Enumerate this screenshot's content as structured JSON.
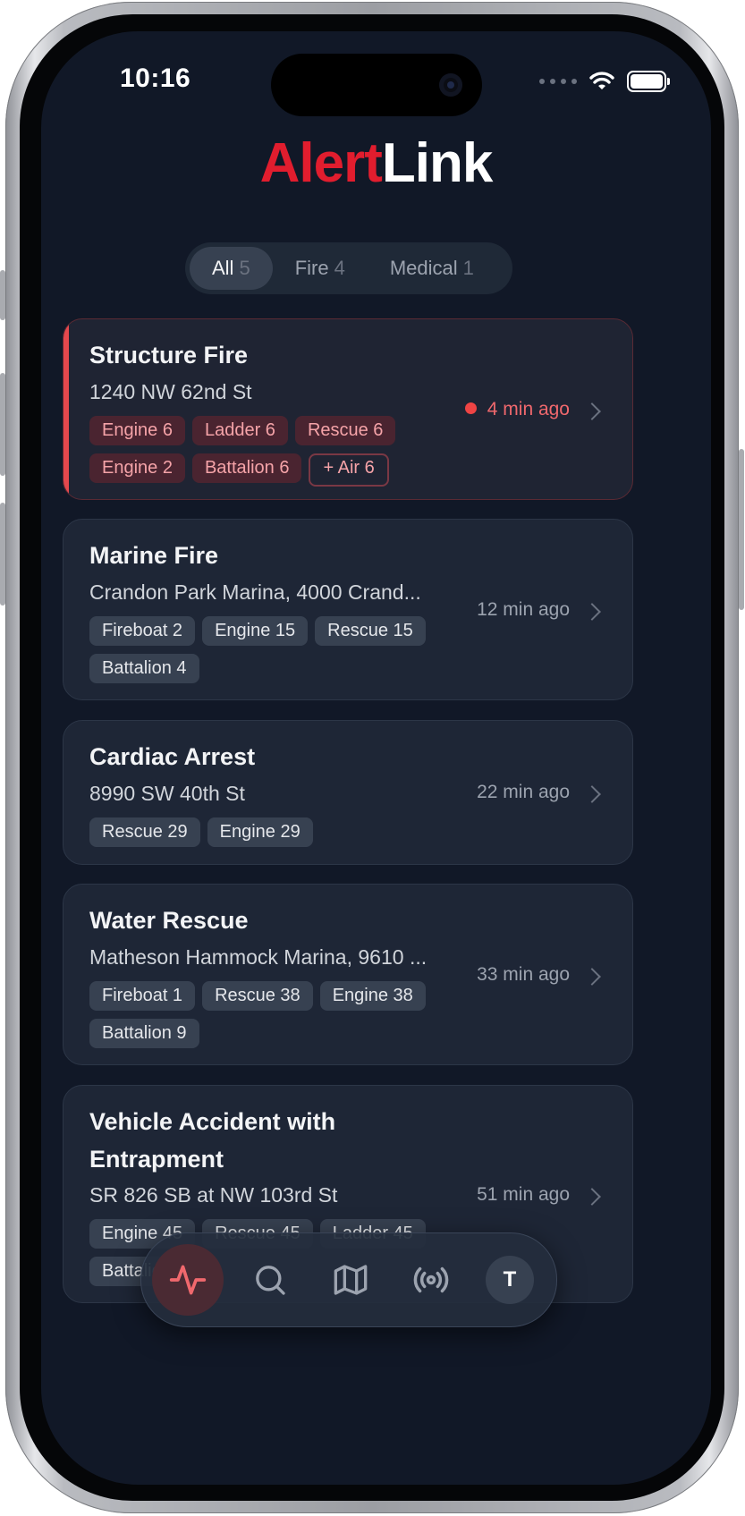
{
  "status_bar": {
    "time": "10:16"
  },
  "app": {
    "logo_part1": "Alert",
    "logo_part2": "Link"
  },
  "filters": [
    {
      "label": "All",
      "count": "5",
      "active": true
    },
    {
      "label": "Fire",
      "count": "4",
      "active": false
    },
    {
      "label": "Medical",
      "count": "1",
      "active": false
    }
  ],
  "incidents": [
    {
      "title": "Structure Fire",
      "address": "1240 NW 62nd St",
      "time": "4 min ago",
      "units": [
        "Engine 6",
        "Ladder 6",
        "Rescue 6",
        "Engine 2",
        "Battalion 6"
      ],
      "more": "+ Air 6"
    },
    {
      "title": "Marine Fire",
      "address": "Crandon Park Marina, 4000 Crand...",
      "time": "12 min ago",
      "units": [
        "Fireboat 2",
        "Engine 15",
        "Rescue 15",
        "Battalion 4"
      ]
    },
    {
      "title": "Cardiac Arrest",
      "address": "8990 SW 40th St",
      "time": "22 min ago",
      "units": [
        "Rescue 29",
        "Engine 29"
      ]
    },
    {
      "title": "Water Rescue",
      "address": "Matheson Hammock Marina, 9610 ...",
      "time": "33 min ago",
      "units": [
        "Fireboat 1",
        "Rescue 38",
        "Engine 38",
        "Battalion 9"
      ]
    },
    {
      "title_line1": "Vehicle Accident with",
      "title_line2": "Entrapment",
      "address": "SR 826 SB at NW 103rd St",
      "time": "51 min ago",
      "units": [
        "Engine 45",
        "Rescue 45",
        "Ladder 45",
        "Battalion 2"
      ]
    }
  ],
  "tabbar": {
    "items": [
      {
        "icon": "activity-icon",
        "active": true
      },
      {
        "icon": "search-icon",
        "active": false
      },
      {
        "icon": "map-icon",
        "active": false
      },
      {
        "icon": "broadcast-icon",
        "active": false
      }
    ],
    "avatar_initial": "T"
  },
  "colors": {
    "accent": "#e11d2e",
    "background": "#111827",
    "card": "#1e2636"
  }
}
